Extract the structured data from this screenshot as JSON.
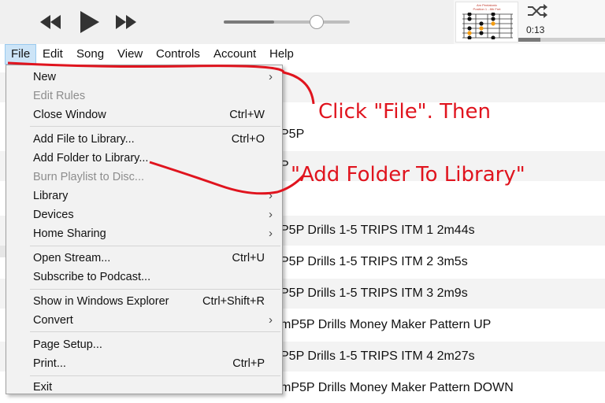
{
  "player": {
    "time_elapsed": "0:13",
    "volume_fraction": 0.4,
    "progress_fraction": 0.25,
    "album_art": {
      "title_line1": "Am Pentatonic",
      "title_line2": "Position 1 - 8th Fret"
    }
  },
  "menubar": {
    "items": [
      "File",
      "Edit",
      "Song",
      "View",
      "Controls",
      "Account",
      "Help"
    ],
    "active": "File"
  },
  "file_menu": {
    "new": "New",
    "edit_rules": "Edit Rules",
    "close_window": "Close Window",
    "close_window_sc": "Ctrl+W",
    "add_file": "Add File to Library...",
    "add_file_sc": "Ctrl+O",
    "add_folder": "Add Folder to Library...",
    "burn_playlist": "Burn Playlist to Disc...",
    "library": "Library",
    "devices": "Devices",
    "home_sharing": "Home Sharing",
    "open_stream": "Open Stream...",
    "open_stream_sc": "Ctrl+U",
    "subscribe_podcast": "Subscribe to Podcast...",
    "show_explorer": "Show in Windows Explorer",
    "show_explorer_sc": "Ctrl+Shift+R",
    "convert": "Convert",
    "page_setup": "Page Setup...",
    "print": "Print...",
    "print_sc": "Ctrl+P",
    "exit": "Exit"
  },
  "songs": [
    "P5P",
    "P",
    "",
    "P5P Drills 1-5 TRIPS ITM 1 2m44s",
    "P5P Drills 1-5 TRIPS ITM 2 3m5s",
    "P5P Drills 1-5 TRIPS ITM 3 2m9s",
    "mP5P Drills Money Maker Pattern UP",
    "P5P Drills 1-5 TRIPS ITM 4 2m27s",
    "mP5P Drills Money Maker Pattern DOWN"
  ],
  "annotations": {
    "line1": "Click \"File\". Then",
    "line2": "\"Add Folder To Library\"",
    "color": "#e0141e"
  },
  "colors": {
    "menu_bg": "#f2f2f2",
    "menubar_active": "#cce4f7",
    "annotation_red": "#e0141e"
  }
}
